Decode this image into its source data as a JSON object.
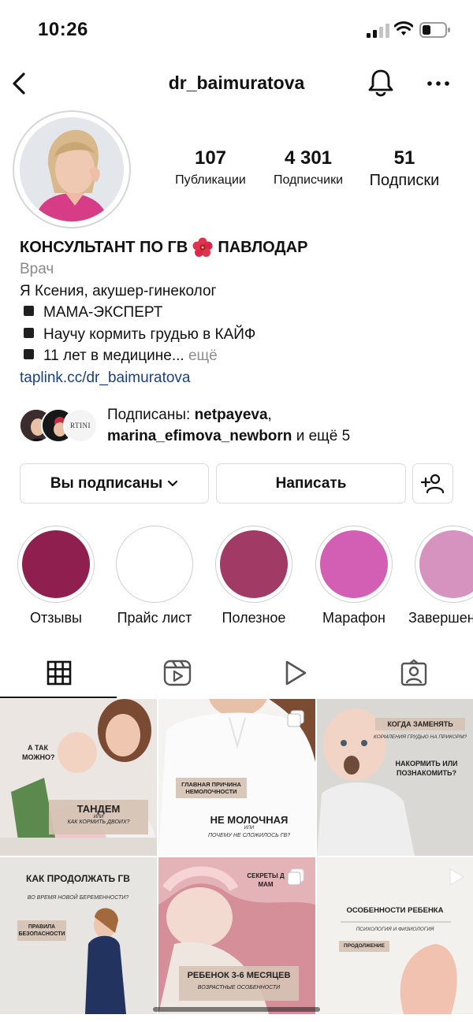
{
  "status_bar": {
    "time": "10:26"
  },
  "header": {
    "username": "dr_baimuratova"
  },
  "stats": [
    {
      "value": "107",
      "label": "Публикации"
    },
    {
      "value": "4 301",
      "label": "Подписчики"
    },
    {
      "value": "51",
      "label": "Подписки"
    }
  ],
  "bio": {
    "name": "КОНСУЛЬТАНТ ПО ГВ",
    "name_suffix": "ПАВЛОДАР",
    "category": "Врач",
    "line1": "Я Ксения, акушер-гинеколог",
    "line2": "МАМА-ЭКСПЕРТ",
    "line3": "Научу кормить грудью в КАЙФ",
    "line4": "11 лет в медицине...",
    "more": "ещё",
    "link": "taplink.cc/dr_baimuratova"
  },
  "followed_by": {
    "prefix": "Подписаны:",
    "user1": "netpayeva",
    "user2": "marina_efimova_newborn",
    "suffix": "и ещё 5",
    "face3_text": "RTINI"
  },
  "buttons": {
    "following": "Вы подписаны",
    "message": "Написать"
  },
  "highlights": [
    {
      "label": "Отзывы",
      "color": "#8e1f4f"
    },
    {
      "label": "Прайс лист",
      "color": "#ffffff"
    },
    {
      "label": "Полезное",
      "color": "#a13b66"
    },
    {
      "label": "Марафон",
      "color": "#d35fb4"
    },
    {
      "label": "Завершен",
      "color": "#d793c0"
    }
  ],
  "tabs": [
    {
      "name": "grid",
      "icon": "grid-icon"
    },
    {
      "name": "reels",
      "icon": "reels-icon"
    },
    {
      "name": "videos",
      "icon": "play-icon"
    },
    {
      "name": "tagged",
      "icon": "tagged-icon"
    }
  ],
  "posts": [
    {
      "top_text": "А ТАК МОЖНО?",
      "title": "ТАНДЕМ",
      "or": "ИЛИ",
      "subtitle": "КАК КОРМИТЬ ДВОИХ?"
    },
    {
      "label": "ГЛАВНАЯ ПРИЧИНА НЕМОЛОЧНОСТИ",
      "title": "НЕ МОЛОЧНАЯ",
      "or": "ИЛИ",
      "subtitle": "ПОЧЕМУ НЕ СЛОЖИЛОСЬ ГВ?"
    },
    {
      "label": "КОГДА ЗАМЕНЯТЬ",
      "subtitle": "КОРМЛЕНИЯ ГРУДЬЮ НА ПРИКОРМ?",
      "title": "НАКОРМИТЬ ИЛИ ПОЗНАКОМИТЬ?"
    },
    {
      "title": "КАК ПРОДОЛЖАТЬ ГВ",
      "subtitle": "ВО ВРЕМЯ НОВОЙ БЕРЕМЕННОСТИ?",
      "label": "ПРАВИЛА БЕЗОПАСНОСТИ"
    },
    {
      "top_text": "СЕКРЕТЫ Д МАМ",
      "title": "РЕБЕНОК 3-6 МЕСЯЦЕВ",
      "subtitle": "ВОЗРАСТНЫЕ ОСОБЕННОСТИ"
    },
    {
      "title": "ОСОБЕННОСТИ РЕБЕНКА",
      "subtitle": "ПСИХОЛОГИЯ И ФИЗИОЛОГИЯ",
      "label": "ПРОДОЛЖЕНИЕ"
    }
  ]
}
